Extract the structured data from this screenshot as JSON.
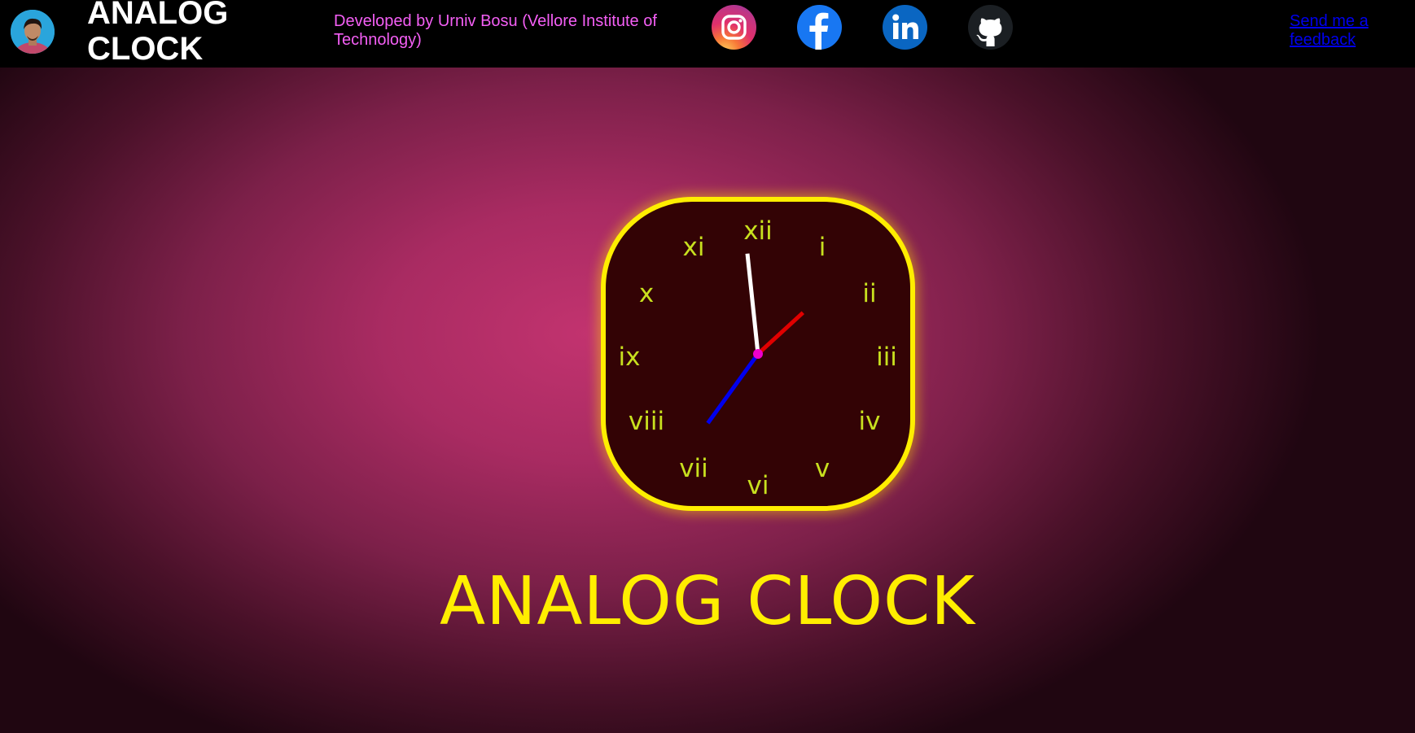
{
  "header": {
    "brand_title": "ANALOG CLOCK",
    "credit": "Developed by Urniv Bosu (Vellore Institute of Technology)",
    "feedback_link": "Send me a feedback",
    "avatar_icon": "profile-photo",
    "social_icons": [
      "instagram-icon",
      "facebook-icon",
      "linkedin-icon",
      "github-icon"
    ]
  },
  "clock": {
    "numerals": [
      "xii",
      "i",
      "ii",
      "iii",
      "iv",
      "v",
      "vi",
      "vii",
      "viii",
      "ix",
      "x",
      "xi"
    ],
    "time": {
      "hour": 1,
      "minute": 35,
      "second": 59
    },
    "hand_colors": {
      "hour": "#e00000",
      "minute": "#0000ee",
      "second": "#ffffff",
      "center": "#ee00cc"
    },
    "face_color": "#330305",
    "border_color": "#ffee00",
    "numeral_color": "#c8e01f"
  },
  "main": {
    "title": "ANALOG CLOCK"
  },
  "colors": {
    "navbar_bg": "#000000",
    "background_center": "#c2336f",
    "title_color": "#ffee00",
    "credit_color": "#f45ff5",
    "link_color": "#0000ee"
  }
}
